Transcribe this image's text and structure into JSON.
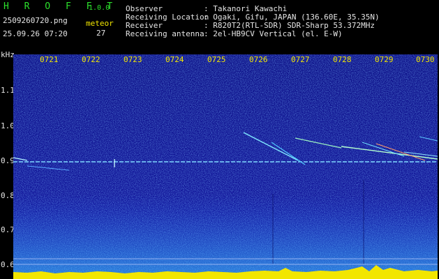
{
  "header": {
    "app_title": "H R O F F T",
    "version": "1.0.0",
    "filename": "2509260720.png",
    "timestamp": "25.09.26 07:20",
    "counter_label": "meteor",
    "counter_value": "27",
    "info_labels": [
      "Observer",
      "Receiving Location",
      "Receiver",
      "Receiving antenna"
    ],
    "info_values": [
      ": Takanori Kawachi",
      ": Ogaki, Gifu, JAPAN (136.60E, 35.35N)",
      ": R820T2(RTL-SDR) SDR-Sharp 53.372MHz",
      ": 2el-HB9CV Vertical (el. E-W)"
    ]
  },
  "spectrogram": {
    "y_unit": "kHz",
    "y_ticks": [
      "1.1",
      "1.0",
      "0.9",
      "0.8",
      "0.7",
      "0.6"
    ],
    "x_ticks": [
      "0721",
      "0722",
      "0723",
      "0724",
      "0725",
      "0726",
      "0727",
      "0728",
      "0729",
      "0730"
    ],
    "colors": {
      "background": "#10128a",
      "label_yellow": "#f2e600",
      "title_green": "#2ce02c"
    }
  }
}
